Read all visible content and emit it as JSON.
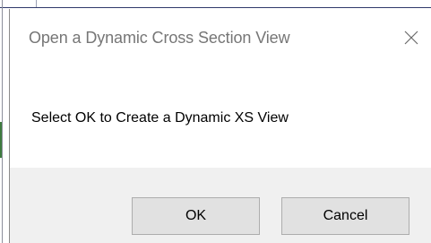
{
  "dialog": {
    "title": "Open a Dynamic Cross Section View",
    "message": "Select OK to Create a Dynamic XS View",
    "close_icon": "close-icon",
    "buttons": {
      "ok_label": "OK",
      "cancel_label": "Cancel"
    }
  },
  "colors": {
    "title_text": "#767676",
    "footer_bg": "#f0f0f0",
    "button_bg": "#e1e1e1",
    "button_border": "#adadad"
  }
}
